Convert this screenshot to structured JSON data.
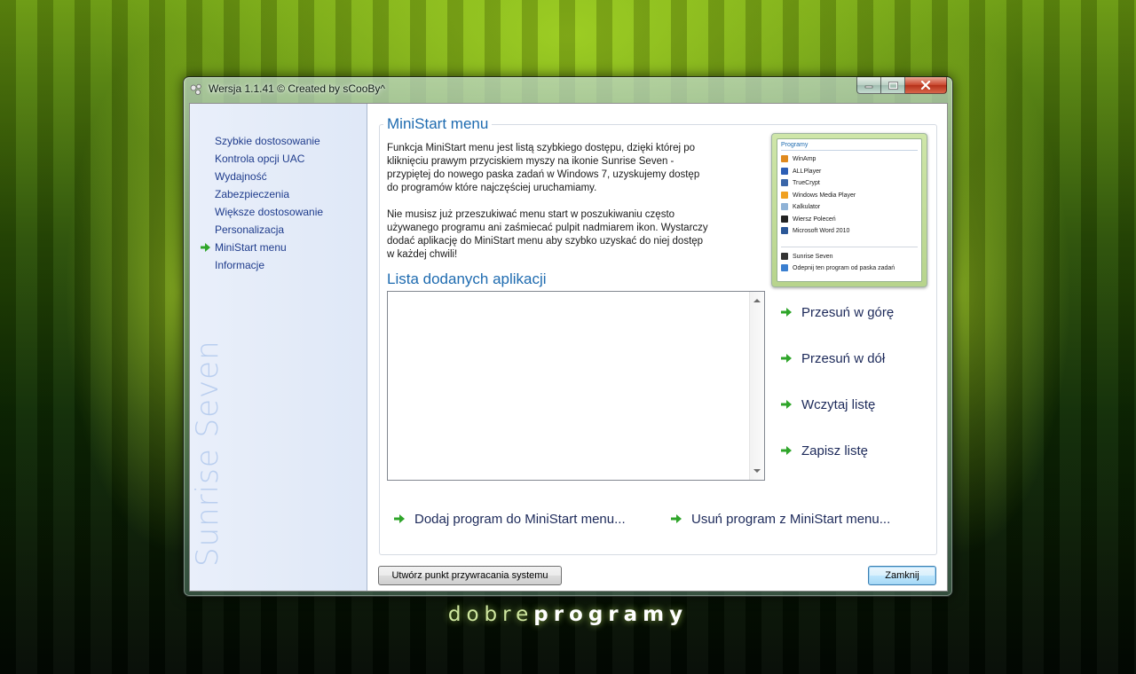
{
  "window": {
    "title": "Wersja 1.1.41 © Created by sCooBy^"
  },
  "sidebar": {
    "items": [
      {
        "label": "Szybkie dostosowanie",
        "active": false
      },
      {
        "label": "Kontrola opcji UAC",
        "active": false
      },
      {
        "label": "Wydajność",
        "active": false
      },
      {
        "label": "Zabezpieczenia",
        "active": false
      },
      {
        "label": "Większe dostosowanie",
        "active": false
      },
      {
        "label": "Personalizacja",
        "active": false
      },
      {
        "label": "MiniStart menu",
        "active": true
      },
      {
        "label": "Informacje",
        "active": false
      }
    ],
    "watermark": "Sunrise Seven"
  },
  "main": {
    "title": "MiniStart menu",
    "description_1": [
      "Funkcja MiniStart menu jest listą szybkiego dostępu, dzięki której po",
      "kliknięciu prawym przyciskiem myszy na ikonie Sunrise Seven -",
      "przypiętej do nowego paska zadań w Windows 7, uzyskujemy dostęp",
      "do programów które najczęściej uruchamiamy."
    ],
    "description_2": [
      "Nie musisz już przeszukiwać menu start w poszukiwaniu często",
      "używanego programu ani zaśmiecać pulpit nadmiarem ikon. Wystarczy",
      "dodać aplikację do MiniStart menu aby szybko uzyskać do niej dostęp",
      "w każdej chwili!"
    ],
    "list_title": "Lista dodanych aplikacji",
    "list_items": [],
    "side_actions": [
      "Przesuń w górę",
      "Przesuń w dół",
      "Wczytaj listę",
      "Zapisz listę"
    ],
    "bottom_actions": [
      "Dodaj program do MiniStart menu...",
      "Usuń program z MiniStart menu..."
    ]
  },
  "preview": {
    "header": "Programy",
    "items": [
      {
        "label": "WinAmp",
        "icon": "winamp-icon",
        "color": "#e08a1e"
      },
      {
        "label": "ALLPlayer",
        "icon": "allplayer-icon",
        "color": "#2d5fb5"
      },
      {
        "label": "TrueCrypt",
        "icon": "truecrypt-icon",
        "color": "#3a66a8"
      },
      {
        "label": "Windows Media Player",
        "icon": "media-player-icon",
        "color": "#f0a020"
      },
      {
        "label": "Kalkulator",
        "icon": "calculator-icon",
        "color": "#8fb2d6"
      },
      {
        "label": "Wiersz Poleceń",
        "icon": "command-prompt-icon",
        "color": "#222222"
      },
      {
        "label": "Microsoft Word 2010",
        "icon": "word-icon",
        "color": "#2b5797"
      }
    ],
    "footer_items": [
      {
        "label": "Sunrise Seven",
        "icon": "sunrise-seven-icon",
        "color": "#333333"
      },
      {
        "label": "Odepnij ten program od paska zadań",
        "icon": "unpin-icon",
        "color": "#3a7fd0"
      }
    ]
  },
  "buttons": {
    "restore_point": "Utwórz punkt przywracania systemu",
    "close": "Zamknij"
  },
  "brand": {
    "light": "dobre",
    "bold": "programy"
  },
  "colors": {
    "accent_title": "#1e6bb0",
    "nav_text": "#1f3c8c",
    "arrow_green": "#2fa52a"
  }
}
